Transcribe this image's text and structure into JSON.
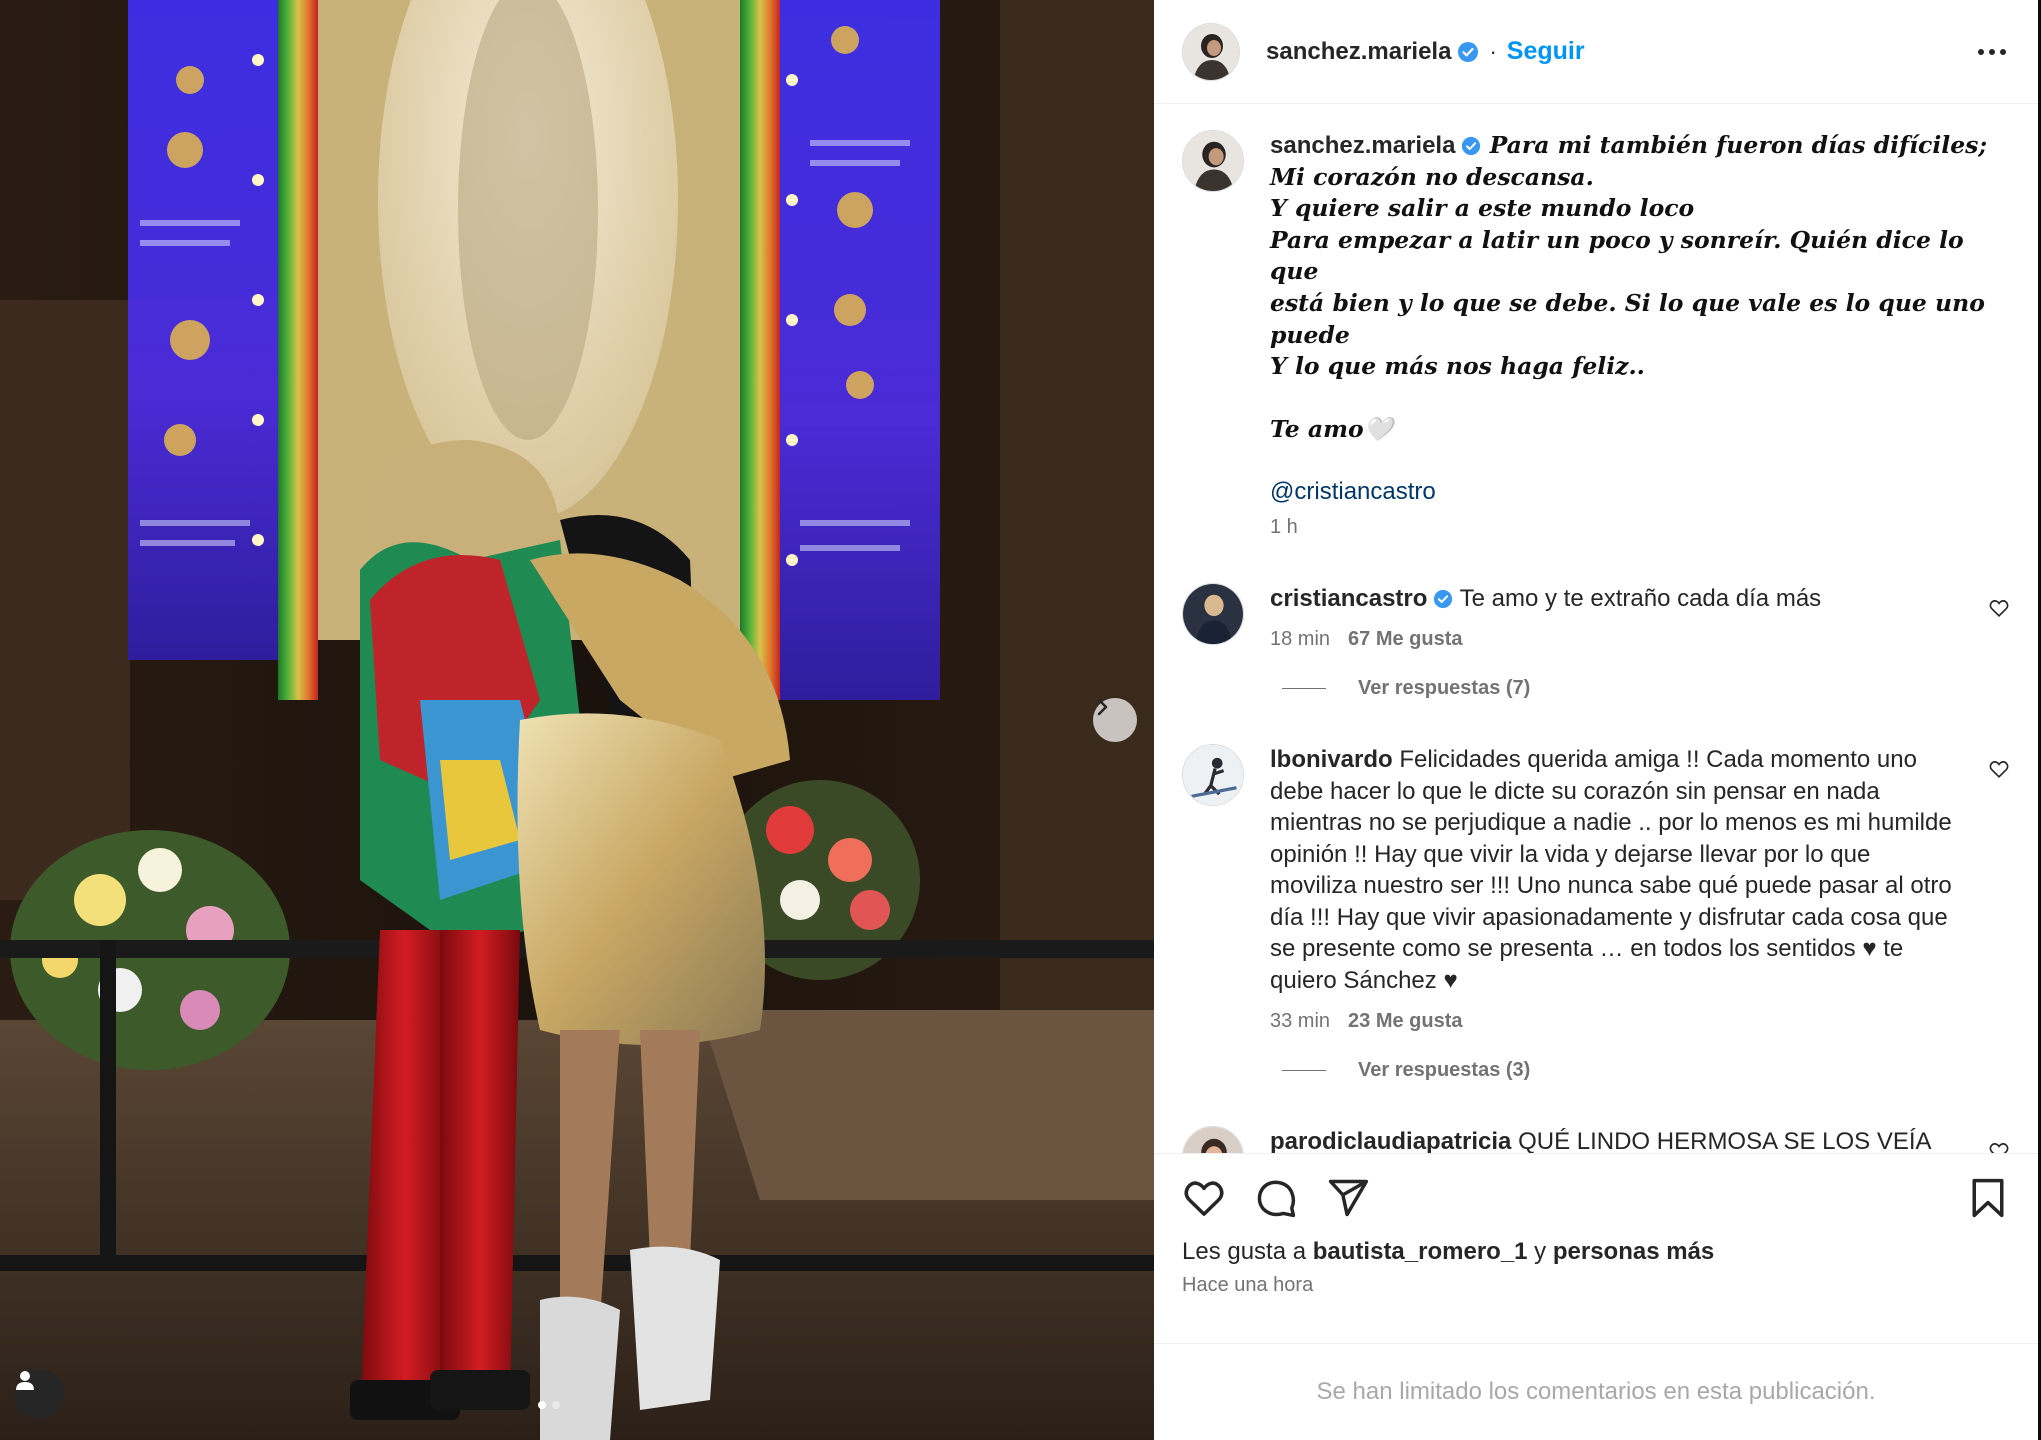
{
  "header": {
    "username": "sanchez.mariela",
    "separator": "·",
    "follow_label": "Seguir",
    "more_icon": "more-horizontal-icon"
  },
  "caption": {
    "username": "sanchez.mariela",
    "lines": [
      "Para mi también fueron días difíciles;",
      "Mi corazón no descansa.",
      "Y quiere salir a este mundo loco",
      "Para empezar a latir un poco y sonreír. Quién dice lo que",
      "está bien y lo que se debe. Si lo que vale es lo que uno puede",
      "Y lo que más nos haga feliz..",
      "",
      "Te amo🤍"
    ],
    "mention": "@cristiancastro",
    "time": "1 h"
  },
  "comments": [
    {
      "username": "cristiancastro",
      "verified": true,
      "text": "Te amo y te extraño cada día más",
      "time": "18 min",
      "likes": "67 Me gusta",
      "replies": "Ver respuestas (7)"
    },
    {
      "username": "lbonivardo",
      "verified": false,
      "text": "Felicidades querida amiga !! Cada momento uno debe hacer lo que le dicte su corazón sin pensar en nada mientras no se perjudique a nadie .. por lo menos es mi humilde opinión !! Hay que vivir la vida y dejarse llevar por lo que moviliza nuestro ser !!! Uno nunca sabe qué puede pasar al otro día !!! Hay que vivir apasionadamente y disfrutar cada cosa que se presente como se presenta … en todos los sentidos ♥ te quiero Sánchez ♥",
      "time": "33 min",
      "likes": "23 Me gusta",
      "replies": "Ver respuestas (3)"
    },
    {
      "username": "parodiclaudiapatricia",
      "verified": false,
      "text": "QUÉ LINDO HERMOSA SE LOS VEÍA MUY FELICES DIOS ACOMODÉ TODO PARA QUÉ SEAS MUY"
    }
  ],
  "actions": {
    "like_icon": "heart-icon",
    "comment_icon": "comment-icon",
    "share_icon": "share-icon",
    "save_icon": "bookmark-icon"
  },
  "likes": {
    "prefix": "Les gusta a ",
    "user": "bautista_romero_1",
    "middle": " y ",
    "rest": "personas más"
  },
  "posted_time": "Hace una hora",
  "comments_limited": "Se han limitado los comentarios en esta publicación.",
  "colors": {
    "accent": "#0095f6",
    "mention": "#00376b",
    "verified": "#3897f0",
    "secondary_text": "#737373"
  }
}
